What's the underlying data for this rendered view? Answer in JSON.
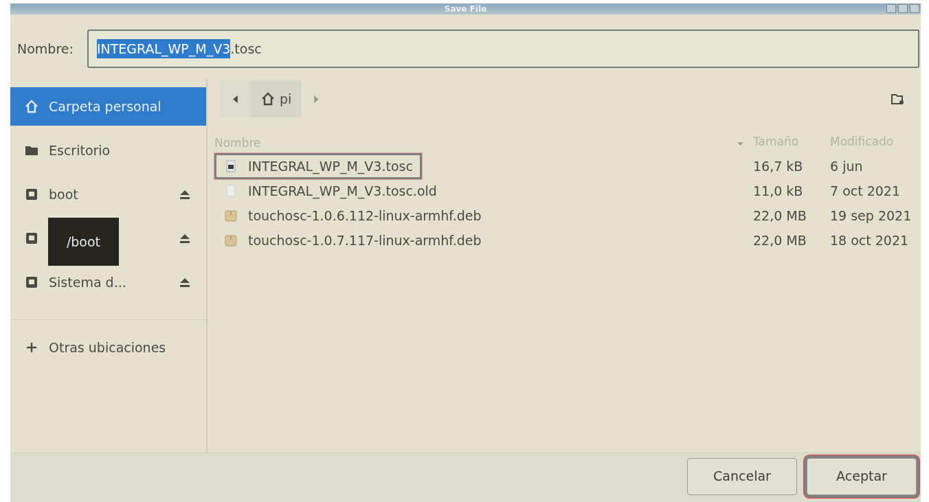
{
  "window": {
    "title": "Save File"
  },
  "name_field": {
    "label": "Nombre:",
    "selected_text": "INTEGRAL_WP_M_V3",
    "rest_text": ".tosc"
  },
  "sidebar": {
    "items": [
      {
        "kind": "home",
        "label": "Carpeta personal",
        "selected": true,
        "ejectable": false
      },
      {
        "kind": "folder",
        "label": "Escritorio",
        "selected": false,
        "ejectable": false
      },
      {
        "kind": "drive",
        "label": "boot",
        "selected": false,
        "ejectable": true
      },
      {
        "kind": "drive",
        "selected": false,
        "ejectable": true,
        "tooltip": "/boot"
      },
      {
        "kind": "drive",
        "label": "Sistema d...",
        "selected": false,
        "ejectable": true
      },
      {
        "kind": "other",
        "label": "Otras ubicaciones",
        "selected": false,
        "ejectable": false
      }
    ]
  },
  "path_bar": {
    "segments": [
      {
        "label": "pi",
        "selected": true
      }
    ]
  },
  "table": {
    "columns": [
      "Nombre",
      "Tamaño",
      "Modificado"
    ],
    "rows": [
      {
        "kind": "document",
        "name": "INTEGRAL_WP_M_V3.tosc",
        "size": "16,7 kB",
        "modified": "6 jun",
        "highlighted": true
      },
      {
        "kind": "blank",
        "name": "INTEGRAL_WP_M_V3.tosc.old",
        "size": "11,0 kB",
        "modified": "7 oct 2021",
        "highlighted": false
      },
      {
        "kind": "package",
        "name": "touchosc-1.0.6.112-linux-armhf.deb",
        "size": "22,0 MB",
        "modified": "19 sep 2021",
        "highlighted": false
      },
      {
        "kind": "package",
        "name": "touchosc-1.0.7.117-linux-armhf.deb",
        "size": "22,0 MB",
        "modified": "18 oct 2021",
        "highlighted": false
      }
    ]
  },
  "buttons": [
    {
      "label": "Cancelar",
      "highlighted": false
    },
    {
      "label": "Aceptar",
      "highlighted": true
    }
  ]
}
